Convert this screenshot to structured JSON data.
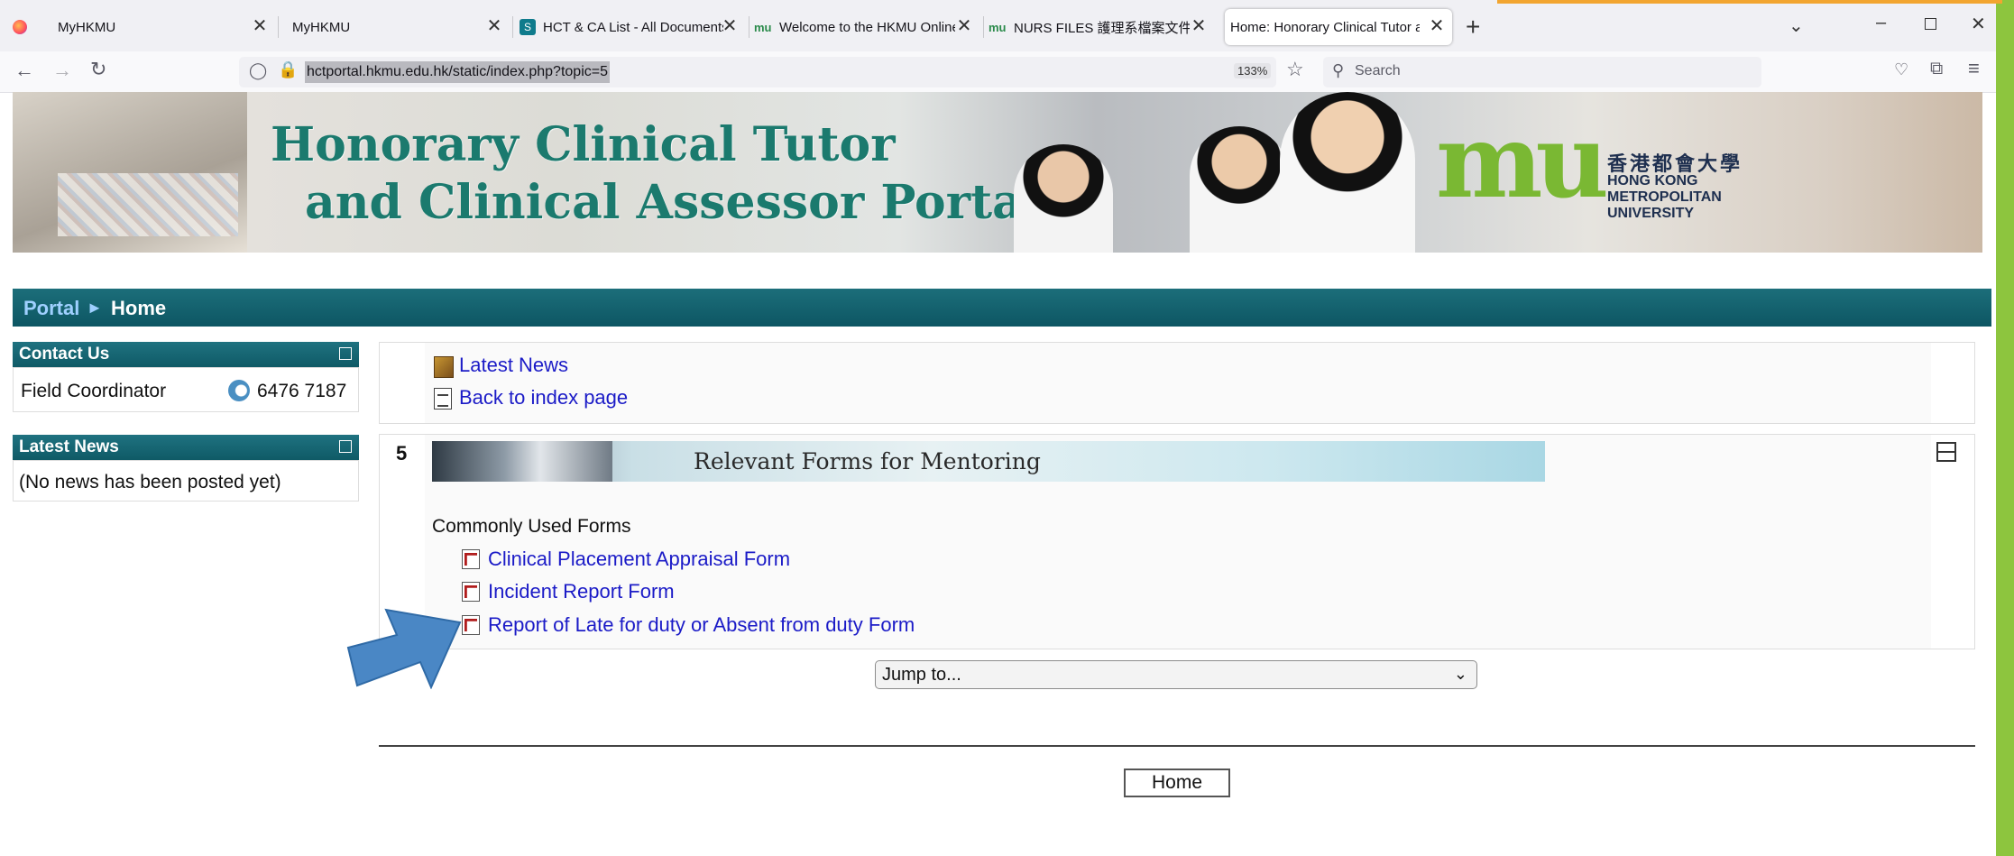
{
  "browser": {
    "tabs": [
      {
        "title": "MyHKMU",
        "close": "✕"
      },
      {
        "title": "MyHKMU",
        "close": "✕"
      },
      {
        "title": "HCT & CA List - All Documents",
        "close": "✕"
      },
      {
        "title": "Welcome to the HKMU Online L",
        "close": "✕"
      },
      {
        "title": "NURS FILES 護理系檔案文件發佈",
        "close": "✕"
      },
      {
        "title": "Home: Honorary Clinical Tutor and",
        "close": "✕"
      }
    ],
    "new_tab": "+",
    "url": "hctportal.hkmu.edu.hk/static/index.php?topic=5",
    "zoom": "133%",
    "search_placeholder": "Search"
  },
  "banner": {
    "title_line1": "Honorary Clinical Tutor",
    "title_line2": "and Clinical Assessor Portal",
    "logo_mark": "mu",
    "logo_chinese": "香港都會大學",
    "logo_en": [
      "HONG KONG",
      "METROPOLITAN",
      "UNIVERSITY"
    ]
  },
  "breadcrumb": {
    "portal": "Portal",
    "separator": "►",
    "current": "Home"
  },
  "sidebar": {
    "contact_us": {
      "title": "Contact Us",
      "label": "Field Coordinator",
      "phone": "6476 7187"
    },
    "latest_news": {
      "title": "Latest News",
      "body": "(No news has been posted yet)"
    }
  },
  "main": {
    "topic_links": {
      "latest_news": "Latest News",
      "back": "Back to index page"
    },
    "section": {
      "number": "5",
      "banner_text": "Relevant Forms for Mentoring",
      "heading": "Commonly Used Forms",
      "forms": [
        "Clinical Placement Appraisal Form",
        "Incident Report Form",
        "Report of Late for duty or Absent from duty Form"
      ]
    },
    "jump_to": "Jump to...",
    "home_button": "Home"
  },
  "colors": {
    "teal": "#0f5a66",
    "link": "#1b1bc7",
    "frame_green": "#8dc53e",
    "arrow": "#4a87c5"
  }
}
